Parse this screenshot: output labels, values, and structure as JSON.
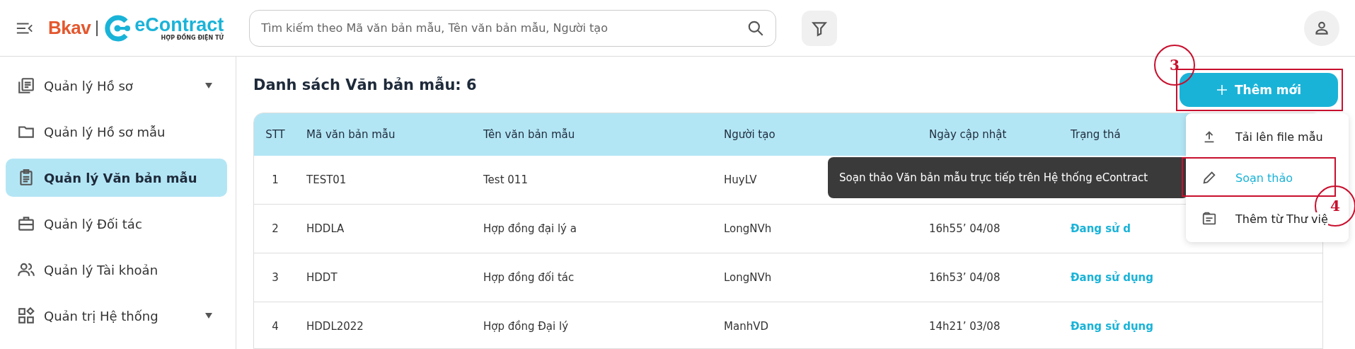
{
  "header": {
    "logo": {
      "brand": "Bkav",
      "product": "eContract",
      "tagline": "HỢP ĐỒNG ĐIỆN TỬ"
    },
    "search": {
      "placeholder": "Tìm kiếm theo Mã văn bản mẫu, Tên văn bản mẫu, Người tạo"
    }
  },
  "sidebar": {
    "items": [
      {
        "label": "Quản lý Hồ sơ",
        "selected": false,
        "expandable": true
      },
      {
        "label": "Quản lý Hồ sơ mẫu",
        "selected": false,
        "expandable": false
      },
      {
        "label": "Quản lý Văn bản mẫu",
        "selected": true,
        "expandable": false
      },
      {
        "label": "Quản lý Đối tác",
        "selected": false,
        "expandable": false
      },
      {
        "label": "Quản lý Tài khoản",
        "selected": false,
        "expandable": false
      },
      {
        "label": "Quản trị Hệ thống",
        "selected": false,
        "expandable": true
      }
    ]
  },
  "main": {
    "title": "Danh sách Văn bản mẫu: 6",
    "add_button": "Thêm mới",
    "table": {
      "columns": [
        "STT",
        "Mã văn bản mẫu",
        "Tên văn bản mẫu",
        "Người tạo",
        "Ngày cập nhật",
        "Trạng thá"
      ],
      "rows": [
        [
          "1",
          "TEST01",
          "Test 011",
          "HuyLV",
          "",
          ""
        ],
        [
          "2",
          "HDDLA",
          "Hợp đồng đại lý a",
          "LongNVh",
          "16h55’ 04/08",
          "Đang sử d"
        ],
        [
          "3",
          "HDDT",
          "Hợp đồng đối tác",
          "LongNVh",
          "16h53’ 04/08",
          "Đang sử dụng"
        ],
        [
          "4",
          "HDDL2022",
          "Hợp đồng Đại lý",
          "ManhVD",
          "14h21’ 03/08",
          "Đang sử dụng"
        ]
      ]
    },
    "menu": [
      {
        "label": "Tải lên file mẫu",
        "selected": false
      },
      {
        "label": "Soạn thảo",
        "selected": true
      },
      {
        "label": "Thêm từ Thư việ",
        "selected": false
      }
    ],
    "tooltip": "Soạn thảo Văn bản mẫu trực tiếp trên Hệ thống eContract"
  },
  "annotations": [
    {
      "number": "3"
    },
    {
      "number": "4"
    }
  ]
}
